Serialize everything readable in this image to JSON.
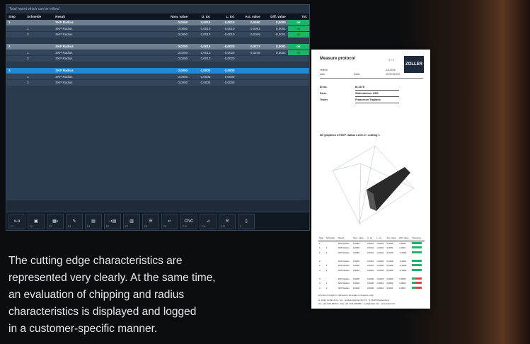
{
  "screen": {
    "title": "Total report which can be edited",
    "columns": [
      "Step",
      "Schneide",
      "Result",
      "Nom. value",
      "U. tol.",
      "L. tol.",
      "Act. value",
      "Diff. value",
      "Tol."
    ],
    "rows": [
      {
        "kind": "group",
        "step": "1",
        "cut": "",
        "result": "SKP Radius",
        "nom": "0,0050",
        "ut": "0,0010",
        "lt": "-0,0010",
        "act": "0,0050",
        "diff": "0,0000",
        "tol": "ok"
      },
      {
        "kind": "sub",
        "step": "",
        "cut": "1",
        "result": "SKP Radius",
        "nom": "0,0050",
        "ut": "0,0010",
        "lt": "-0,0010",
        "act": "0,0051",
        "diff": "0,0001",
        "tol": "ok"
      },
      {
        "kind": "sub",
        "step": "",
        "cut": "2",
        "result": "SKP Radius",
        "nom": "0,0050",
        "ut": "0,0010",
        "lt": "-0,0010",
        "act": "0,0049",
        "diff": "-0,0001",
        "tol": "ok"
      },
      {
        "kind": "empty"
      },
      {
        "kind": "group",
        "step": "2",
        "cut": "",
        "result": "SKP Radius",
        "nom": "0,0250",
        "ut": "0,0010",
        "lt": "-0,0020",
        "act": "0,0277",
        "diff": "0,0001",
        "tol": "ok"
      },
      {
        "kind": "sub",
        "step": "",
        "cut": "1",
        "result": "SKP Radius",
        "nom": "0,0250",
        "ut": "0,0010",
        "lt": "-0,0020",
        "act": "0,0248",
        "diff": "0,0002",
        "tol": "ok"
      },
      {
        "kind": "sub",
        "step": "",
        "cut": "2",
        "result": "SKP Radius",
        "nom": "0,0250",
        "ut": "0,0010",
        "lt": "-0,0020",
        "act": "",
        "diff": "",
        "tol": ""
      },
      {
        "kind": "empty"
      },
      {
        "kind": "group sel",
        "step": "3",
        "cut": "",
        "result": "SKP Radius",
        "nom": "0,0000",
        "ut": "0,0000",
        "lt": "-0,0000",
        "act": "",
        "diff": "",
        "tol": ""
      },
      {
        "kind": "sub",
        "step": "",
        "cut": "1",
        "result": "SKP Radius",
        "nom": "0,0000",
        "ut": "0,0000",
        "lt": "-0,0000",
        "act": "",
        "diff": "",
        "tol": ""
      },
      {
        "kind": "sub",
        "step": "",
        "cut": "2",
        "result": "SKP Radius",
        "nom": "0,0000",
        "ut": "0,0000",
        "lt": "-0,0000",
        "act": "",
        "diff": "",
        "tol": ""
      }
    ],
    "empty_rows": 19,
    "toolbar": [
      {
        "icon": "x-alpha-icon",
        "glyph": "x-α",
        "fk": "F1"
      },
      {
        "icon": "save-icon",
        "glyph": "▣",
        "fk": "F2"
      },
      {
        "icon": "grid-dots-icon",
        "glyph": "▦▪",
        "fk": "F3"
      },
      {
        "icon": "pen-icon",
        "glyph": "✎",
        "fk": "F4"
      },
      {
        "icon": "table-icon",
        "glyph": "▤",
        "fk": "F5"
      },
      {
        "icon": "table-arrow-icon",
        "glyph": "⇢▤",
        "fk": "F6"
      },
      {
        "icon": "columns-icon",
        "glyph": "▥",
        "fk": "F7"
      },
      {
        "icon": "list-icon",
        "glyph": "☰",
        "fk": "F8"
      },
      {
        "icon": "return-icon",
        "glyph": "↵",
        "fk": "F9"
      },
      {
        "icon": "cnc-icon",
        "glyph": "CNC",
        "fk": "F10"
      },
      {
        "icon": "chart-icon",
        "glyph": "⊿",
        "fk": "F11"
      },
      {
        "icon": "radius-icon",
        "glyph": "R",
        "fk": "F12"
      },
      {
        "icon": "lock-icon",
        "glyph": "▯",
        "fk": "F"
      }
    ]
  },
  "doc": {
    "title": "Measure protocol",
    "page": "1 / 1",
    "logo": "ZOLLER",
    "meta_left": [
      "»Mein«",
      "User"
    ],
    "meta_mid": [
      "",
      "Zoller"
    ],
    "meta_right": [
      "4.8.2016",
      "15:39:35 AM"
    ],
    "fields": [
      {
        "label": "ID no.",
        "value": "M-1678"
      },
      {
        "label": "Desc.",
        "value": "Stufenbohrer HSS"
      },
      {
        "label": "Tester",
        "value": "Francesco Trapiano"
      }
    ],
    "graph_title": "3D graphics of SKP radius Level 2 / cutting 1",
    "table_cols": [
      "Step",
      "Schneide",
      "Result",
      "Nom. value",
      "U. tol.",
      "L. tol.",
      "Act. value",
      "Diff. value",
      "Tolerance"
    ],
    "table_rows": [
      [
        "1",
        "",
        "SKP Radius",
        "0,0050",
        "0,0010",
        "-0,0010",
        "0,0050",
        "0,0000",
        "g"
      ],
      [
        "1",
        "1",
        "SKP Radius",
        "0,0050",
        "0,0010",
        "-0,0010",
        "0,0051",
        "0,0001",
        "g"
      ],
      [
        "1",
        "2",
        "SKP Radius",
        "0,0050",
        "0,0010",
        "-0,0010",
        "0,0049",
        "-0,0001",
        "g"
      ],
      [
        "gap"
      ],
      [
        "2",
        "",
        "SKP Radius",
        "0,0250",
        "0,0010",
        "-0,0020",
        "0,0249",
        "-0,0001",
        "g"
      ],
      [
        "2",
        "1",
        "SKP Radius",
        "0,0250",
        "0,0010",
        "-0,0020",
        "0,0248",
        "-0,0002",
        "g"
      ],
      [
        "2",
        "2",
        "SKP Radius",
        "0,0250",
        "0,0010",
        "-0,0020",
        "0,0249",
        "-0,0001",
        "g"
      ],
      [
        "gap"
      ],
      [
        "3",
        "",
        "SKP Radius",
        "0,0000",
        "0,0000",
        "-0,0010",
        "0,0000",
        "0,0000",
        "r"
      ],
      [
        "3",
        "1",
        "SKP Radius",
        "0,0000",
        "0,0000",
        "-0,0010",
        "0,0000",
        "0,0000",
        "r"
      ],
      [
        "3",
        "2",
        "SKP Radius",
        "0,0000",
        "0,0000",
        "-0,0010",
        "0,0001",
        "0,0001",
        "r"
      ]
    ],
    "footer": [
      "All units of length in millimeters, all angles in degrees units.",
      "E. Zoller GmbH & Co. KG · Gottlieb-Daimler-Str. 19 · D-74385 Pleidelsheim",
      "Tel. +49 7144 8970-0 · Fax +49 7144 8060807 · post@zoller.info · www.zoller.info"
    ]
  },
  "caption": [
    "The cutting edge characteristics are",
    "represented very clearly. At the same time,",
    "an evaluation of chipping and radius",
    "characteristics is displayed and logged",
    "in a customer-specific manner."
  ]
}
